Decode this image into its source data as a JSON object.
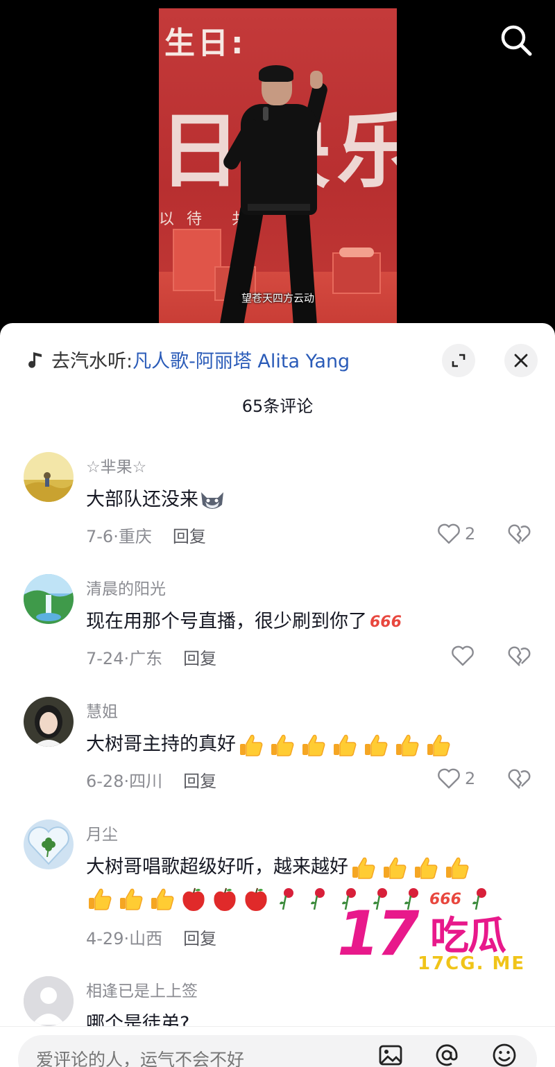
{
  "video": {
    "banner_title": "生日:",
    "banner_big": "日快乐",
    "banner_sub": "以待  共",
    "subtitle": "望苍天四方云动"
  },
  "icons": {
    "search": "search-icon",
    "music": "music-note-icon",
    "expand": "expand-icon",
    "close": "close-icon",
    "like": "heart-outline-icon",
    "dislike": "broken-heart-icon",
    "image": "image-icon",
    "mention": "at-icon",
    "emoji": "emoji-icon"
  },
  "music": {
    "prefix": "去汽水听:",
    "title": "凡人歌-阿丽塔 Alita Yang"
  },
  "comment_count": "65条评论",
  "reply_label": "回复",
  "comments": [
    {
      "name": "☆芈果☆",
      "text": "大部队还没来",
      "date": "7-6",
      "location": "重庆",
      "likes": "2"
    },
    {
      "name": "清晨的阳光",
      "text": "现在用那个号直播，很少刷到你了",
      "date": "7-24",
      "location": "广东",
      "likes": ""
    },
    {
      "name": "慧姐",
      "text": "大树哥主持的真好",
      "date": "6-28",
      "location": "四川",
      "likes": "2"
    },
    {
      "name": "月尘",
      "text": "大树哥唱歌超级好听，越来越好",
      "date": "4-29",
      "location": "山西",
      "likes": ""
    },
    {
      "name": "相逢已是上上签",
      "text": "哪个是徒弟?"
    }
  ],
  "emoji_666": "666",
  "input": {
    "placeholder": "爱评论的人，运气不会不好"
  },
  "watermark": {
    "big": "17",
    "cn": "吃瓜",
    "url": "17CG. ME"
  },
  "colors": {
    "link": "#2a5bb8",
    "secondary_text": "#8a8b91",
    "watermark_pink": "#e8198b",
    "watermark_yellow": "#f0c419"
  }
}
